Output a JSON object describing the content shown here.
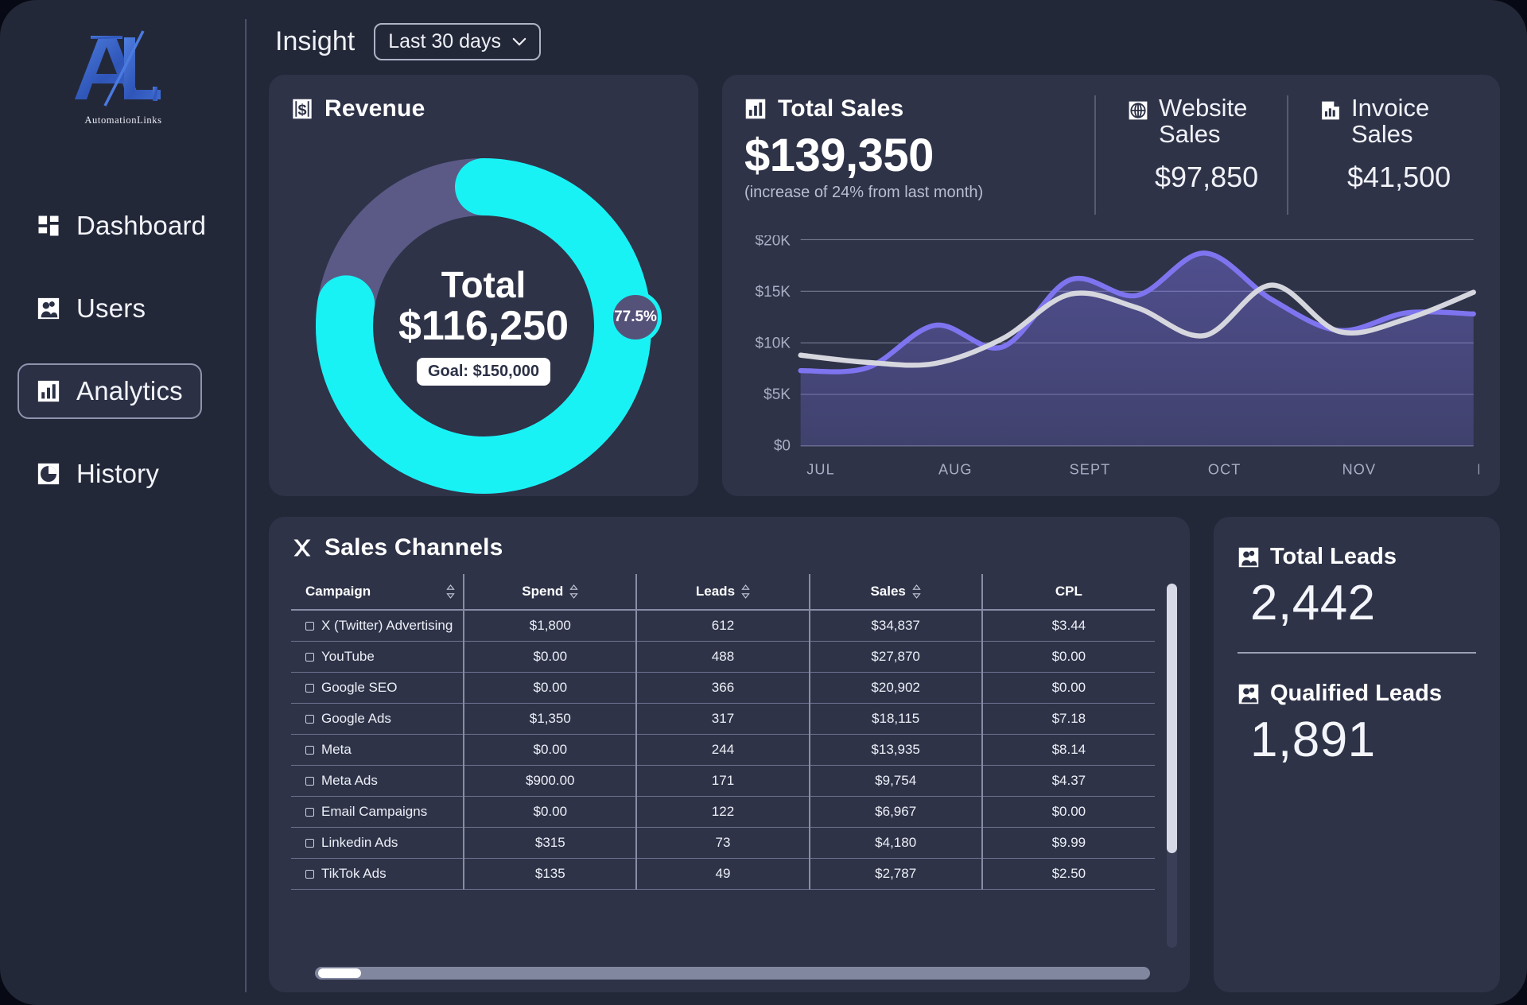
{
  "brand": {
    "name": "AutomationLinks",
    "monogram": "A/L"
  },
  "sidebar": {
    "items": [
      {
        "label": "Dashboard",
        "icon": "grid-icon",
        "active": false
      },
      {
        "label": "Users",
        "icon": "users-icon",
        "active": false
      },
      {
        "label": "Analytics",
        "icon": "bar-chart-icon",
        "active": true
      },
      {
        "label": "History",
        "icon": "clock-pie-icon",
        "active": false
      }
    ]
  },
  "header": {
    "title": "Insight",
    "range_value": "Last 30 days"
  },
  "revenue": {
    "title": "Revenue",
    "icon": "dollar-icon",
    "total_label": "Total",
    "total_value": "$116,250",
    "goal_label": "Goal: $150,000",
    "percent_badge": "77.5%",
    "percent": 77.5,
    "ring_color": "#18f2f5",
    "track_color": "#5b5a86"
  },
  "total_sales": {
    "title": "Total Sales",
    "icon": "bar-chart-icon",
    "amount": "$139,350",
    "subtext": "(increase of 24% from last month)",
    "stats": [
      {
        "title": "Website Sales",
        "value": "$97,850",
        "icon": "globe-icon"
      },
      {
        "title": "Invoice Sales",
        "value": "$41,500",
        "icon": "invoice-icon"
      }
    ]
  },
  "chart_data": {
    "type": "line",
    "title": "Total Sales",
    "xlabel": "",
    "ylabel": "",
    "categories": [
      "JUL",
      "AUG",
      "SEPT",
      "OCT",
      "NOV",
      "DEC"
    ],
    "ytick_labels": [
      "$0",
      "$5K",
      "$10K",
      "$15K",
      "$20K"
    ],
    "ytick_values": [
      0,
      5000,
      10000,
      15000,
      20000
    ],
    "ylim": [
      0,
      20000
    ],
    "grid": true,
    "legend": "none",
    "series": [
      {
        "name": "Website Sales",
        "color": "#7f74ef",
        "filled": true,
        "x": [
          0,
          0.5,
          1,
          1.5,
          2,
          2.5,
          3,
          3.5,
          4,
          4.5,
          5
        ],
        "values": [
          7300,
          7600,
          11700,
          9600,
          16100,
          14600,
          18700,
          14200,
          11200,
          12900,
          12800
        ]
      },
      {
        "name": "Invoice Sales",
        "color": "#d6d7de",
        "filled": false,
        "x": [
          0,
          0.5,
          1,
          1.5,
          2,
          2.5,
          3,
          3.5,
          4,
          4.5,
          5
        ],
        "values": [
          8800,
          8100,
          8000,
          10400,
          14700,
          13400,
          10700,
          15600,
          11100,
          12300,
          14900
        ]
      }
    ]
  },
  "channels": {
    "title": "Sales Channels",
    "icon": "channels-icon",
    "columns": [
      {
        "label": "Campaign",
        "sortable": true,
        "align": "left"
      },
      {
        "label": "Spend",
        "sortable": true,
        "align": "center"
      },
      {
        "label": "Leads",
        "sortable": true,
        "align": "center"
      },
      {
        "label": "Sales",
        "sortable": true,
        "align": "center"
      },
      {
        "label": "CPL",
        "sortable": false,
        "align": "center"
      }
    ],
    "rows": [
      {
        "campaign": "X (Twitter) Advertising",
        "spend": "$1,800",
        "leads": "612",
        "sales": "$34,837",
        "cpl": "$3.44"
      },
      {
        "campaign": "YouTube",
        "spend": "$0.00",
        "leads": "488",
        "sales": "$27,870",
        "cpl": "$0.00"
      },
      {
        "campaign": "Google SEO",
        "spend": "$0.00",
        "leads": "366",
        "sales": "$20,902",
        "cpl": "$0.00"
      },
      {
        "campaign": "Google Ads",
        "spend": "$1,350",
        "leads": "317",
        "sales": "$18,115",
        "cpl": "$7.18"
      },
      {
        "campaign": "Meta",
        "spend": "$0.00",
        "leads": "244",
        "sales": "$13,935",
        "cpl": "$8.14"
      },
      {
        "campaign": "Meta Ads",
        "spend": "$900.00",
        "leads": "171",
        "sales": "$9,754",
        "cpl": "$4.37"
      },
      {
        "campaign": "Email Campaigns",
        "spend": "$0.00",
        "leads": "122",
        "sales": "$6,967",
        "cpl": "$0.00"
      },
      {
        "campaign": "Linkedin Ads",
        "spend": "$315",
        "leads": "73",
        "sales": "$4,180",
        "cpl": "$9.99"
      },
      {
        "campaign": "TikTok Ads",
        "spend": "$135",
        "leads": "49",
        "sales": "$2,787",
        "cpl": "$2.50"
      }
    ]
  },
  "leads": {
    "total": {
      "title": "Total Leads",
      "value": "2,442",
      "icon": "users-icon"
    },
    "qualified": {
      "title": "Qualified Leads",
      "value": "1,891",
      "icon": "users-icon"
    }
  }
}
